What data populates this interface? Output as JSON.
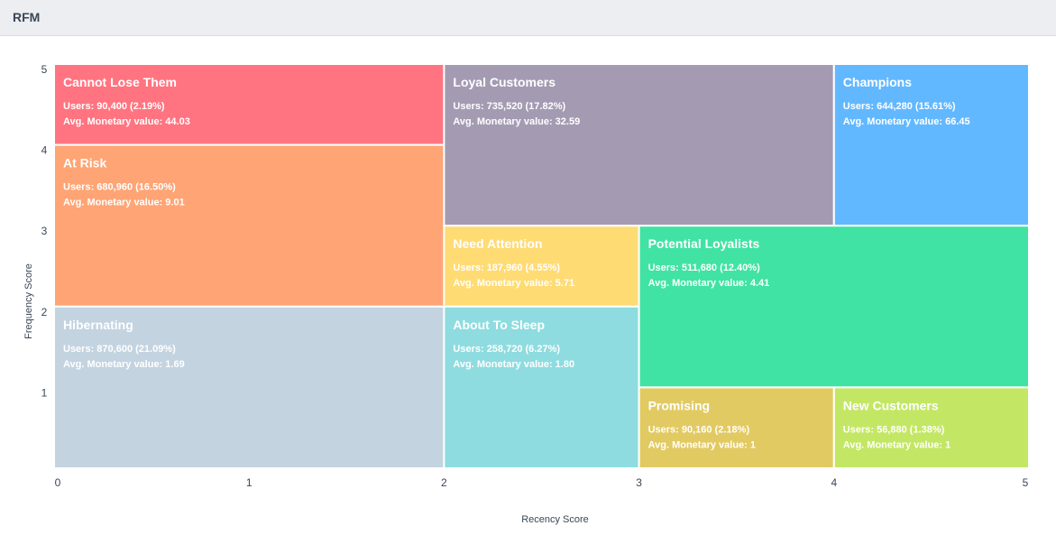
{
  "header": {
    "title": "RFM"
  },
  "chart_data": {
    "type": "heatmap",
    "xlabel": "Recency Score",
    "ylabel": "Frequency Score",
    "xlim": [
      0,
      5
    ],
    "ylim": [
      0,
      5
    ],
    "xticks": [
      "0",
      "1",
      "2",
      "3",
      "4",
      "5"
    ],
    "yticks": [
      "1",
      "2",
      "3",
      "4",
      "5"
    ],
    "users_prefix": "Users: ",
    "monetary_prefix": "Avg. Monetary value: ",
    "segments": [
      {
        "name": "Cannot Lose Them",
        "users": "90,400 (2.19%)",
        "avg_monetary": "44.03",
        "x": [
          0,
          2
        ],
        "y": [
          4,
          5
        ],
        "color": "#ff7480"
      },
      {
        "name": "At Risk",
        "users": "680,960 (16.50%)",
        "avg_monetary": "9.01",
        "x": [
          0,
          2
        ],
        "y": [
          2,
          4
        ],
        "color": "#ffa474"
      },
      {
        "name": "Hibernating",
        "users": "870,600 (21.09%)",
        "avg_monetary": "1.69",
        "x": [
          0,
          2
        ],
        "y": [
          0,
          2
        ],
        "color": "#c3d3e0"
      },
      {
        "name": "Loyal Customers",
        "users": "735,520 (17.82%)",
        "avg_monetary": "32.59",
        "x": [
          2,
          4
        ],
        "y": [
          3,
          5
        ],
        "color": "#a49bb3"
      },
      {
        "name": "Champions",
        "users": "644,280 (15.61%)",
        "avg_monetary": "66.45",
        "x": [
          4,
          5
        ],
        "y": [
          3,
          5
        ],
        "color": "#62b8ff"
      },
      {
        "name": "Need Attention",
        "users": "187,960 (4.55%)",
        "avg_monetary": "5.71",
        "x": [
          2,
          3
        ],
        "y": [
          2,
          3
        ],
        "color": "#ffdb74"
      },
      {
        "name": "About To Sleep",
        "users": "258,720 (6.27%)",
        "avg_monetary": "1.80",
        "x": [
          2,
          3
        ],
        "y": [
          0,
          2
        ],
        "color": "#8edcdf"
      },
      {
        "name": "Potential Loyalists",
        "users": "511,680 (12.40%)",
        "avg_monetary": "4.41",
        "x": [
          3,
          5
        ],
        "y": [
          1,
          3
        ],
        "color": "#40e3a3"
      },
      {
        "name": "Promising",
        "users": "90,160 (2.18%)",
        "avg_monetary": "1",
        "x": [
          3,
          4
        ],
        "y": [
          0,
          1
        ],
        "color": "#e2ca63"
      },
      {
        "name": "New Customers",
        "users": "56,880 (1.38%)",
        "avg_monetary": "1",
        "x": [
          4,
          5
        ],
        "y": [
          0,
          1
        ],
        "color": "#c3e764"
      }
    ]
  }
}
